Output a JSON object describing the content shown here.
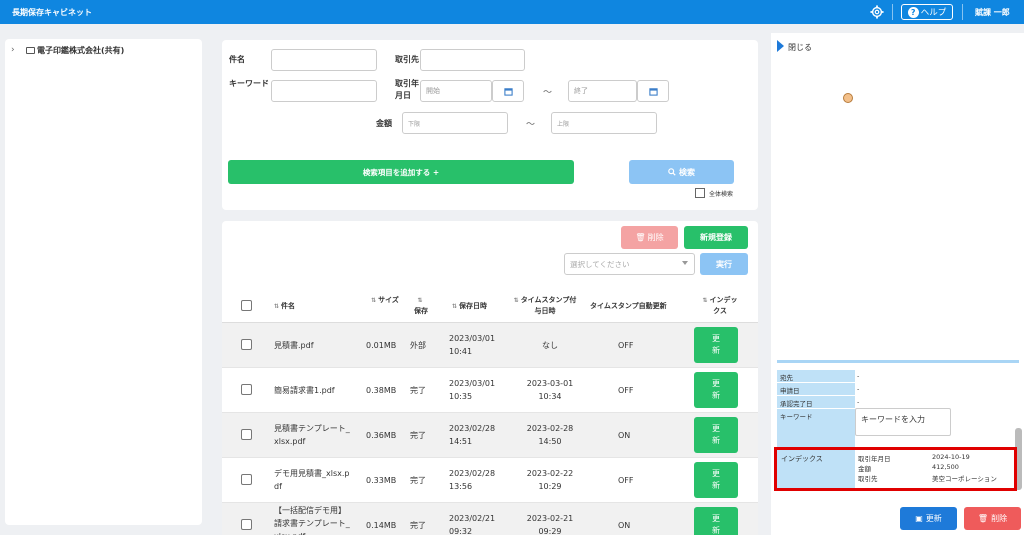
{
  "header": {
    "app_title": "長期保存キャビネット",
    "help_label": "ヘルプ",
    "user_name": "賦課 一郎"
  },
  "sidebar": {
    "tree_root": "電子印鑑株式会社(共有)"
  },
  "search": {
    "name_label": "件名",
    "partner_label": "取引先",
    "keyword_label": "キーワード",
    "date_label": "取引年月日",
    "date_start_placeholder": "開始",
    "date_end_placeholder": "終了",
    "range_sep": "〜",
    "amount_label": "金額",
    "amount_min_placeholder": "下限",
    "amount_max_placeholder": "上限",
    "add_field_button": "検索項目を追加する +",
    "search_button": "検索",
    "fulltext_label": "全体検索"
  },
  "list": {
    "delete_button": "削除",
    "new_button": "新規登録",
    "action_placeholder": "選択してください",
    "execute_button": "実行",
    "columns": {
      "name": "件名",
      "size": "サイズ",
      "status": "保存",
      "saved_at": "保存日時",
      "timestamp": "タイムスタンプ付与日時",
      "auto": "タイムスタンプ自動更新",
      "index": "インデックス"
    },
    "update_label": "更新",
    "rows": [
      {
        "name": "見積書.pdf",
        "size": "0.01MB",
        "status": "外部",
        "saved_at": "2023/03/01\n10:41",
        "timestamp": "なし",
        "auto": "OFF"
      },
      {
        "name": "簡易請求書1.pdf",
        "size": "0.38MB",
        "status": "完了",
        "saved_at": "2023/03/01\n10:35",
        "timestamp": "2023-03-01\n10:34",
        "auto": "OFF"
      },
      {
        "name": "見積書テンプレート_\nxlsx.pdf",
        "size": "0.36MB",
        "status": "完了",
        "saved_at": "2023/02/28\n14:51",
        "timestamp": "2023-02-28\n14:50",
        "auto": "ON"
      },
      {
        "name": "デモ用見積書_xlsx.p\ndf",
        "size": "0.33MB",
        "status": "完了",
        "saved_at": "2023/02/28\n13:56",
        "timestamp": "2023-02-22\n10:29",
        "auto": "OFF"
      },
      {
        "name": "【一括配信デモ用】\n請求書テンプレート_\nxlsx.pdf",
        "size": "0.14MB",
        "status": "完了",
        "saved_at": "2023/02/21\n09:32",
        "timestamp": "2023-02-21\n09:29",
        "auto": "ON"
      }
    ]
  },
  "detail": {
    "close_label": "閉じる",
    "props": [
      {
        "key": "宛先",
        "value": "-"
      },
      {
        "key": "申請日",
        "value": "-"
      },
      {
        "key": "承認完了日",
        "value": "-"
      }
    ],
    "keyword_key": "キーワード",
    "keyword_value": "キーワードを入力",
    "index_key": "インデックス",
    "index_items": [
      {
        "key": "取引年月日",
        "value": "2024-10-19"
      },
      {
        "key": "金額",
        "value": "412,500"
      },
      {
        "key": "取引先",
        "value": "美空コーポレーション"
      }
    ],
    "update_button": "更新",
    "delete_button": "削除"
  },
  "colors": {
    "primary": "#0f86e0",
    "green": "#28c06a",
    "highlight": "#e00000"
  }
}
